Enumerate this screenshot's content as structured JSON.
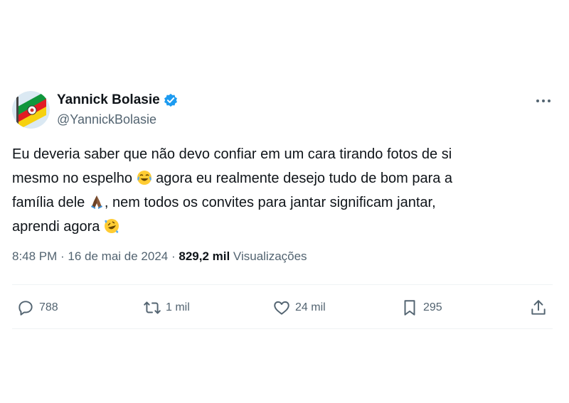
{
  "author": {
    "display_name": "Yannick Bolasie",
    "handle": "@YannickBolasie",
    "verified": true,
    "avatar": "flag-avatar-icon"
  },
  "tweet": {
    "line1": "Eu deveria saber que não devo confiar em um cara tirando fotos de si",
    "line2_before_emoji": "mesmo no espelho ",
    "line2_after_emoji": " agora eu realmente desejo tudo de bom para a",
    "line3_before_emoji": "família dele ",
    "line3_after_emoji": ", nem todos os convites para jantar significam jantar,",
    "line4": "aprendi agora ",
    "emojis": [
      "tears-of-joy-emoji",
      "folded-hands-emoji",
      "rolling-laughing-emoji"
    ]
  },
  "meta": {
    "time": "8:48 PM",
    "separator1": " · ",
    "date": "16 de mai de 2024",
    "separator2": " · ",
    "views_count": "829,2 mil",
    "views_label": " Visualizações"
  },
  "actions": {
    "replies": "788",
    "retweets": "1 mil",
    "likes": "24 mil",
    "bookmarks": "295"
  },
  "colors": {
    "text": "#0f1419",
    "secondary": "#536471",
    "verified": "#1d9bf0",
    "divider": "#eff3f4"
  }
}
